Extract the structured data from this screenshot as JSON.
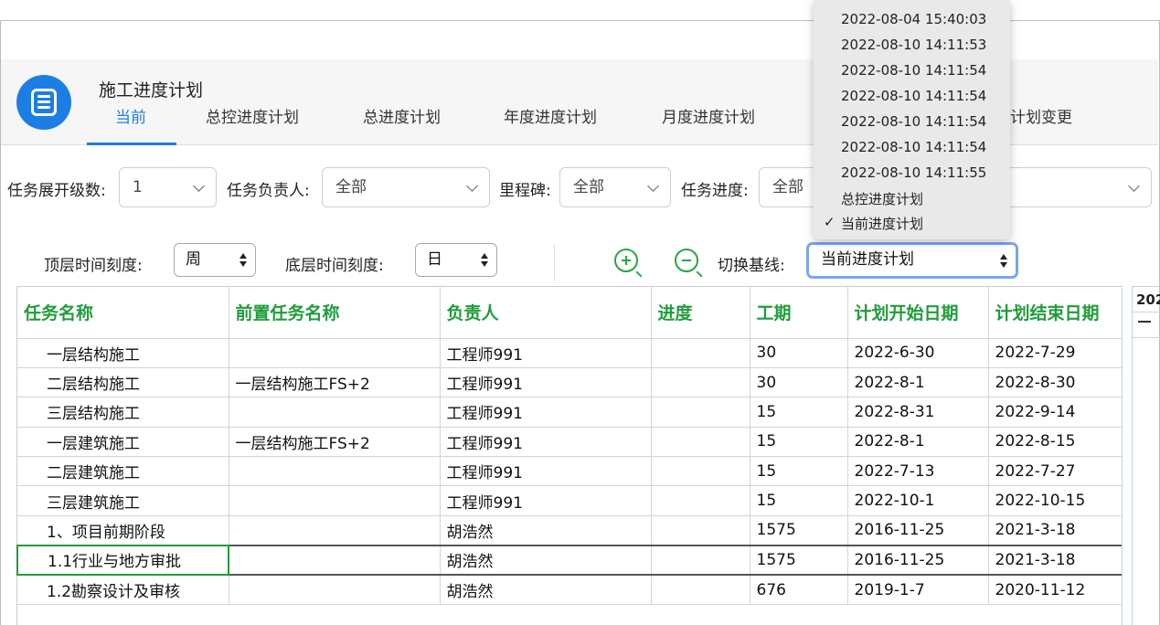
{
  "header": {
    "title": "施工进度计划",
    "tabs": [
      {
        "label": "当前",
        "active": true
      },
      {
        "label": "总控进度计划"
      },
      {
        "label": "总进度计划"
      },
      {
        "label": "年度进度计划"
      },
      {
        "label": "月度进度计划"
      },
      {
        "label": "计划变更"
      }
    ]
  },
  "filters": {
    "level_label": "任务展开级数:",
    "level_value": "1",
    "owner_label": "任务负责人:",
    "owner_value": "全部",
    "milestone_label": "里程碑:",
    "milestone_value": "全部",
    "progress_label": "任务进度:",
    "progress_value": "全部"
  },
  "toolbar": {
    "top_scale_label": "顶层时间刻度:",
    "top_scale_value": "周",
    "bottom_scale_label": "底层时间刻度:",
    "bottom_scale_value": "日",
    "baseline_label": "切换基线:",
    "baseline_value": "当前进度计划",
    "zoom_in_icon": "zoom-in-icon",
    "zoom_out_icon": "zoom-out-icon",
    "accent_color": "#28a745"
  },
  "dropdown": {
    "options": [
      "2022-08-04 15:40:03",
      "2022-08-10 14:11:53",
      "2022-08-10 14:11:54",
      "2022-08-10 14:11:54",
      "2022-08-10 14:11:54",
      "2022-08-10 14:11:54",
      "2022-08-10 14:11:55",
      "总控进度计划",
      "当前进度计划"
    ],
    "selected_index": 8,
    "check_mark": "✓"
  },
  "table": {
    "header_color": "#1f9d3a",
    "columns": [
      "任务名称",
      "前置任务名称",
      "负责人",
      "进度",
      "工期",
      "计划开始日期",
      "计划结束日期"
    ],
    "rows": [
      [
        "一层结构施工",
        "",
        "工程师991",
        "",
        "30",
        "2022-6-30",
        "2022-7-29"
      ],
      [
        "二层结构施工",
        "一层结构施工FS+2",
        "工程师991",
        "",
        "30",
        "2022-8-1",
        "2022-8-30"
      ],
      [
        "三层结构施工",
        "",
        "工程师991",
        "",
        "15",
        "2022-8-31",
        "2022-9-14"
      ],
      [
        "一层建筑施工",
        "一层结构施工FS+2",
        "工程师991",
        "",
        "15",
        "2022-8-1",
        "2022-8-15"
      ],
      [
        "二层建筑施工",
        "",
        "工程师991",
        "",
        "15",
        "2022-7-13",
        "2022-7-27"
      ],
      [
        "三层建筑施工",
        "",
        "工程师991",
        "",
        "15",
        "2022-10-1",
        "2022-10-15"
      ],
      [
        "1、项目前期阶段",
        "",
        "胡浩然",
        "",
        "1575",
        "2016-11-25",
        "2021-3-18"
      ],
      [
        "1.1行业与地方审批",
        "",
        "胡浩然",
        "",
        "1575",
        "2016-11-25",
        "2021-3-18"
      ],
      [
        "1.2勘察设计及审核",
        "",
        "胡浩然",
        "",
        "676",
        "2019-1-7",
        "2020-11-12"
      ]
    ],
    "selected_row": 7
  },
  "gantt": {
    "year_label": "202",
    "dash": "—"
  }
}
